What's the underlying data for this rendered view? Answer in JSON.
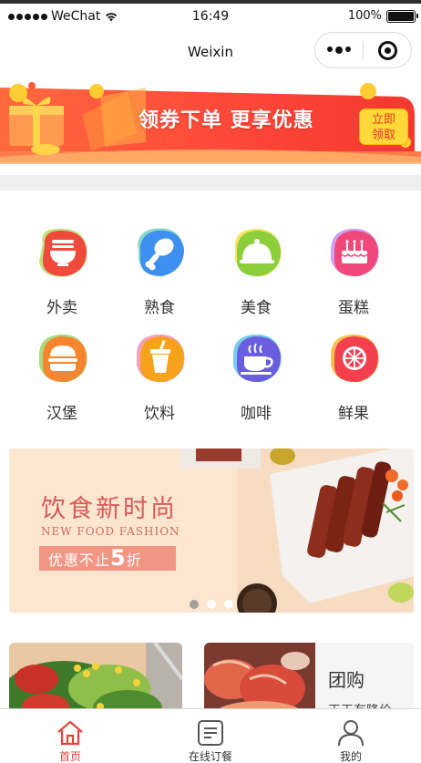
{
  "status_bar": {
    "carrier": "WeChat",
    "time": "16:49",
    "battery": "100%",
    "battery_level": 1.0
  },
  "nav": {
    "title": "Weixin"
  },
  "coupon_banner": {
    "text": "领券下单 更享优惠",
    "button_line1": "立即",
    "button_line2": "领取"
  },
  "categories": [
    {
      "label": "外卖",
      "icon": "noodle-bowl-icon",
      "color": "#ef4a3c"
    },
    {
      "label": "熟食",
      "icon": "drumstick-icon",
      "color": "#3d8ff0"
    },
    {
      "label": "美食",
      "icon": "cloche-icon",
      "color": "#8ccf3a"
    },
    {
      "label": "蛋糕",
      "icon": "cake-icon",
      "color": "#f0487a"
    },
    {
      "label": "汉堡",
      "icon": "burger-icon",
      "color": "#f5852e"
    },
    {
      "label": "饮料",
      "icon": "drink-cup-icon",
      "color": "#f7a21c"
    },
    {
      "label": "咖啡",
      "icon": "coffee-cup-icon",
      "color": "#6a5de0"
    },
    {
      "label": "鲜果",
      "icon": "citrus-icon",
      "color": "#f2404f"
    }
  ],
  "food_banner": {
    "title": "饮食新时尚",
    "subtitle": "NEW FOOD FASHION",
    "tag_prefix": "优惠不止",
    "tag_number": "5",
    "tag_suffix": "折",
    "pages": 3,
    "active_page": 1
  },
  "cards": {
    "group_buy_title": "团购",
    "group_buy_desc": "天天有降价"
  },
  "tabs": [
    {
      "label": "首页",
      "icon": "home-icon",
      "active": true
    },
    {
      "label": "在线订餐",
      "icon": "order-list-icon",
      "active": false
    },
    {
      "label": "我的",
      "icon": "user-icon",
      "active": false
    }
  ],
  "colors": {
    "accent": "#e0453a",
    "coupon_yellow": "#ffd83a",
    "banner_bg": "#fde4cd"
  }
}
